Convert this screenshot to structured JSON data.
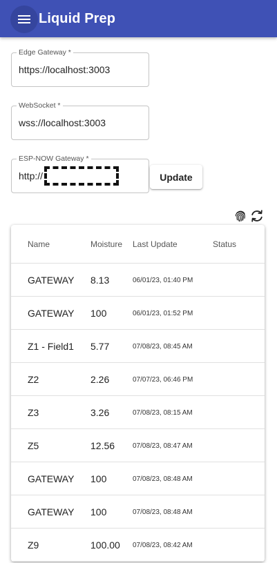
{
  "app": {
    "title": "Liquid Prep",
    "menu_icon": "hamburger-menu-icon",
    "brand_color": "#3f51b5"
  },
  "form": {
    "edge_gateway": {
      "label": "Edge Gateway *",
      "value": "https://localhost:3003"
    },
    "websocket": {
      "label": "WebSocket *",
      "value": "wss://localhost:3003"
    },
    "espnow_gateway": {
      "label": "ESP-NOW Gateway *",
      "value": "http://"
    },
    "update_label": "Update"
  },
  "toolbar": {
    "fingerprint_icon": "fingerprint-icon",
    "sync_icon": "sync-icon"
  },
  "table": {
    "headers": {
      "name": "Name",
      "moisture": "Moisture",
      "last_update": "Last Update",
      "status": "Status"
    },
    "rows": [
      {
        "name": "GATEWAY",
        "moisture": "8.13",
        "last_update": "06/01/23, 01:40 PM",
        "status": ""
      },
      {
        "name": "GATEWAY",
        "moisture": "100",
        "last_update": "06/01/23, 01:52 PM",
        "status": ""
      },
      {
        "name": "Z1 - Field1",
        "moisture": "5.77",
        "last_update": "07/08/23, 08:45 AM",
        "status": ""
      },
      {
        "name": "Z2",
        "moisture": "2.26",
        "last_update": "07/07/23, 06:46 PM",
        "status": ""
      },
      {
        "name": "Z3",
        "moisture": "3.26",
        "last_update": "07/08/23, 08:15 AM",
        "status": ""
      },
      {
        "name": "Z5",
        "moisture": "12.56",
        "last_update": "07/08/23, 08:47 AM",
        "status": ""
      },
      {
        "name": "GATEWAY",
        "moisture": "100",
        "last_update": "07/08/23, 08:48 AM",
        "status": ""
      },
      {
        "name": "GATEWAY",
        "moisture": "100",
        "last_update": "07/08/23, 08:48 AM",
        "status": ""
      },
      {
        "name": "Z9",
        "moisture": "100.00",
        "last_update": "07/08/23, 08:42 AM",
        "status": ""
      }
    ]
  }
}
